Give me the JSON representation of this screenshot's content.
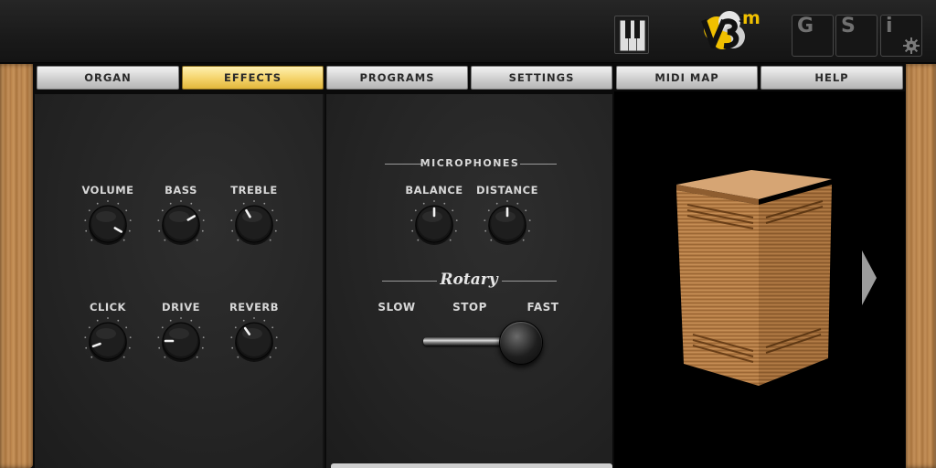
{
  "header": {
    "logo_text": "V3",
    "logo_superscript": "m",
    "buttons": [
      {
        "id": "g",
        "label": "G"
      },
      {
        "id": "s",
        "label": "S"
      },
      {
        "id": "i",
        "label": "i"
      }
    ],
    "icons": {
      "keyboard": "piano-keys-icon",
      "settings": "gear-icon"
    }
  },
  "tabs": [
    {
      "label": "ORGAN",
      "active": false
    },
    {
      "label": "EFFECTS",
      "active": true
    },
    {
      "label": "PROGRAMS",
      "active": false
    },
    {
      "label": "SETTINGS",
      "active": false
    },
    {
      "label": "MIDI MAP",
      "active": false
    },
    {
      "label": "HELP",
      "active": false
    }
  ],
  "effects": {
    "knobs": [
      {
        "label": "VOLUME",
        "angle": 120
      },
      {
        "label": "BASS",
        "angle": 60
      },
      {
        "label": "TREBLE",
        "angle": -30
      },
      {
        "label": "CLICK",
        "angle": -110
      },
      {
        "label": "DRIVE",
        "angle": -90
      },
      {
        "label": "REVERB",
        "angle": -35
      }
    ]
  },
  "microphones": {
    "title": "MICROPHONES",
    "knobs": [
      {
        "label": "BALANCE",
        "angle": 0
      },
      {
        "label": "DISTANCE",
        "angle": 0
      }
    ]
  },
  "rotary": {
    "title": "Rotary",
    "speeds": [
      "SLOW",
      "STOP",
      "FAST"
    ],
    "selected": "FAST"
  },
  "colors": {
    "active_tab": "#f4d36a",
    "logo_yellow": "#f0c000",
    "wood": "#b9844a"
  }
}
